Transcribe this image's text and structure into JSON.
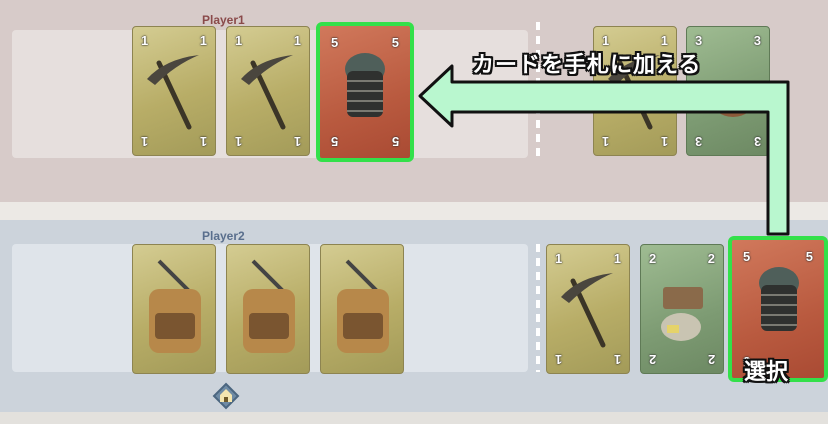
{
  "players": {
    "player1_label": "Player1",
    "player2_label": "Player2"
  },
  "annotations": {
    "add_to_hand": "カードを手札に加える",
    "select": "選択"
  },
  "colors": {
    "highlight": "#33e04a",
    "arrow_fill": "#b9f7cf",
    "arrow_border": "#111111"
  },
  "cards": {
    "p1_hand": [
      {
        "type": "pickaxe",
        "num": "1"
      },
      {
        "type": "pickaxe",
        "num": "1"
      },
      {
        "type": "helmet",
        "num": "5",
        "highlighted": true
      }
    ],
    "p1_table": [
      {
        "type": "pickaxe",
        "num": "1"
      },
      {
        "type": "green-item",
        "num": "3"
      }
    ],
    "p2_hand": [
      {
        "type": "backpack"
      },
      {
        "type": "backpack"
      },
      {
        "type": "backpack"
      }
    ],
    "p2_table": [
      {
        "type": "pickaxe",
        "num": "1"
      },
      {
        "type": "chest",
        "num": "2"
      },
      {
        "type": "helmet",
        "num": "5",
        "highlighted": true
      }
    ]
  },
  "icons": {
    "home": "home-icon"
  }
}
